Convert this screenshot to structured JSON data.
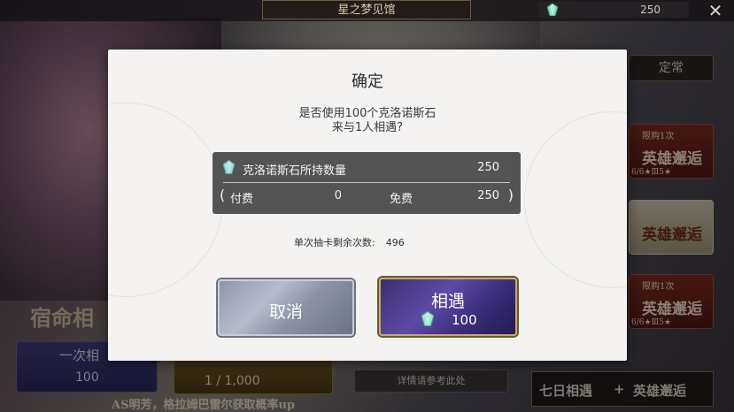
{
  "header": {
    "title": "星之梦见馆",
    "currency_amount": "250",
    "currency_icon": "crystal-gem-icon",
    "close_icon": "close-icon"
  },
  "sidebar": {
    "regular_tab": "定常",
    "tabs": [
      {
        "tag": "限购1次",
        "main": "英雄邂逅",
        "sub": "6/6★Ⅲ5★"
      },
      {
        "tag": "",
        "main": "英雄邂逅",
        "sub": ""
      },
      {
        "tag": "限购1次",
        "main": "英雄邂逅",
        "sub": "6/6★Ⅲ5★"
      }
    ],
    "bottom_left": "七日相遇",
    "bottom_sep": "+",
    "bottom_right": "英雄邂逅"
  },
  "background": {
    "fate_title": "宿命相",
    "draw_one_label": "一次相",
    "draw_one_cost": "100",
    "draw_ten_cost": "1 / 1,000",
    "details_button": "详情请参考此处",
    "bottom_note": "AS明芳，格拉姆巴雷尔获取概率up"
  },
  "dialog": {
    "title": "确定",
    "message_line1": "是否使用100个克洛诺斯石",
    "message_line2": "来与1人相遇?",
    "holdings_label": "克洛诺斯石所持数量",
    "holdings_total": "250",
    "paren_open": "(",
    "paren_close": ")",
    "paid_label": "付费",
    "paid_value": "0",
    "free_label": "免费",
    "free_value": "250",
    "remaining_label": "单次抽卡剩余次数:",
    "remaining_value": "496",
    "cancel_button": "取消",
    "confirm_button": "相遇",
    "confirm_cost": "100"
  },
  "colors": {
    "dialog_bg": "#f4f3f1",
    "info_box_bg": "#555455",
    "confirm_bg": "#4a3a8e",
    "confirm_border": "#c9a86a",
    "cancel_bg": "#9aa0b2"
  }
}
